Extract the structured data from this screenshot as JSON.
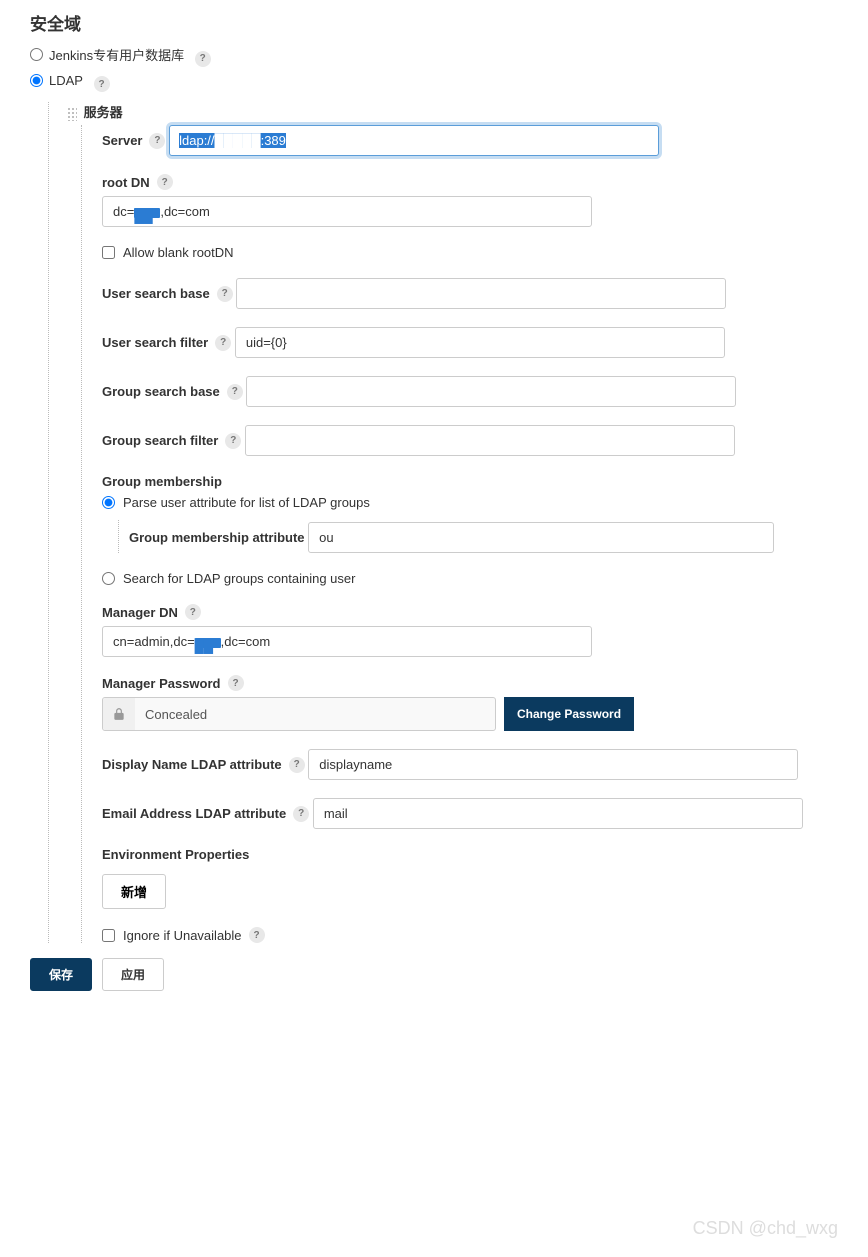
{
  "section_title": "安全域",
  "realm_options": {
    "jenkins": "Jenkins专有用户数据库",
    "ldap": "LDAP"
  },
  "server_section": {
    "header_cn": "服务器",
    "server_label": "Server",
    "server_value_prefix": "ldap://",
    "server_value_suffix": ":389",
    "root_dn_label": "root DN",
    "root_dn_prefix": "dc=",
    "root_dn_suffix": ",dc=com",
    "allow_blank_rootdn": "Allow blank rootDN",
    "user_search_base_label": "User search base",
    "user_search_base_value": "",
    "user_search_filter_label": "User search filter",
    "user_search_filter_value": "uid={0}",
    "group_search_base_label": "Group search base",
    "group_search_base_value": "",
    "group_search_filter_label": "Group search filter",
    "group_search_filter_value": "",
    "group_membership_label": "Group membership",
    "group_parse_option": "Parse user attribute for list of LDAP groups",
    "group_membership_attr_label": "Group membership attribute",
    "group_membership_attr_value": "ou",
    "group_search_option": "Search for LDAP groups containing user",
    "manager_dn_label": "Manager DN",
    "manager_dn_prefix": "cn=admin,dc=",
    "manager_dn_suffix": ",dc=com",
    "manager_password_label": "Manager Password",
    "concealed_text": "Concealed",
    "change_password_btn": "Change Password",
    "display_name_label": "Display Name LDAP attribute",
    "display_name_value": "displayname",
    "email_attr_label": "Email Address LDAP attribute",
    "email_attr_value": "mail",
    "env_props_label": "Environment Properties",
    "add_btn": "新增",
    "ignore_unavailable": "Ignore if Unavailable"
  },
  "footer": {
    "save": "保存",
    "apply": "应用"
  },
  "watermark": "CSDN @chd_wxg"
}
